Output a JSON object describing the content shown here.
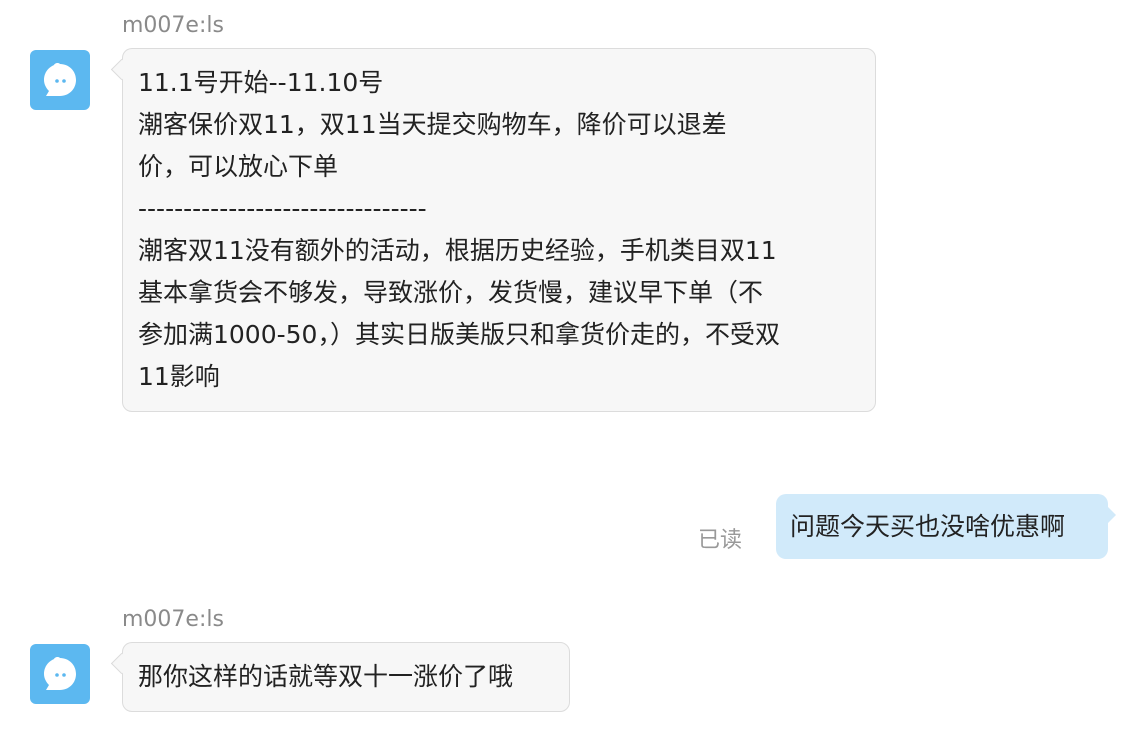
{
  "conversation": {
    "messages": [
      {
        "sender": "m007e:ls",
        "lines": [
          "11.1号开始--11.10号",
          "潮客保价双11，双11当天提交购物车，降价可以退差",
          "价，可以放心下单",
          "--------------------------------",
          "潮客双11没有额外的活动，根据历史经验，手机类目双11",
          "基本拿货会不够发，导致涨价，发货慢，建议早下单（不",
          "参加满1000-50，）其实日版美版只和拿货价走的，不受双",
          "11影响"
        ]
      },
      {
        "text": "问题今天买也没啥优惠啊",
        "status": "已读"
      },
      {
        "sender": "m007e:ls",
        "lines": [
          "那你这样的话就等双十一涨价了哦"
        ]
      }
    ]
  },
  "colors": {
    "avatar": "#5cb8f0",
    "incoming_bubble": "#f7f7f7",
    "outgoing_bubble": "#d1eafa",
    "meta_text": "#8a8a8a"
  },
  "icons": {
    "avatar": "chat-bubble-mascot-icon"
  }
}
